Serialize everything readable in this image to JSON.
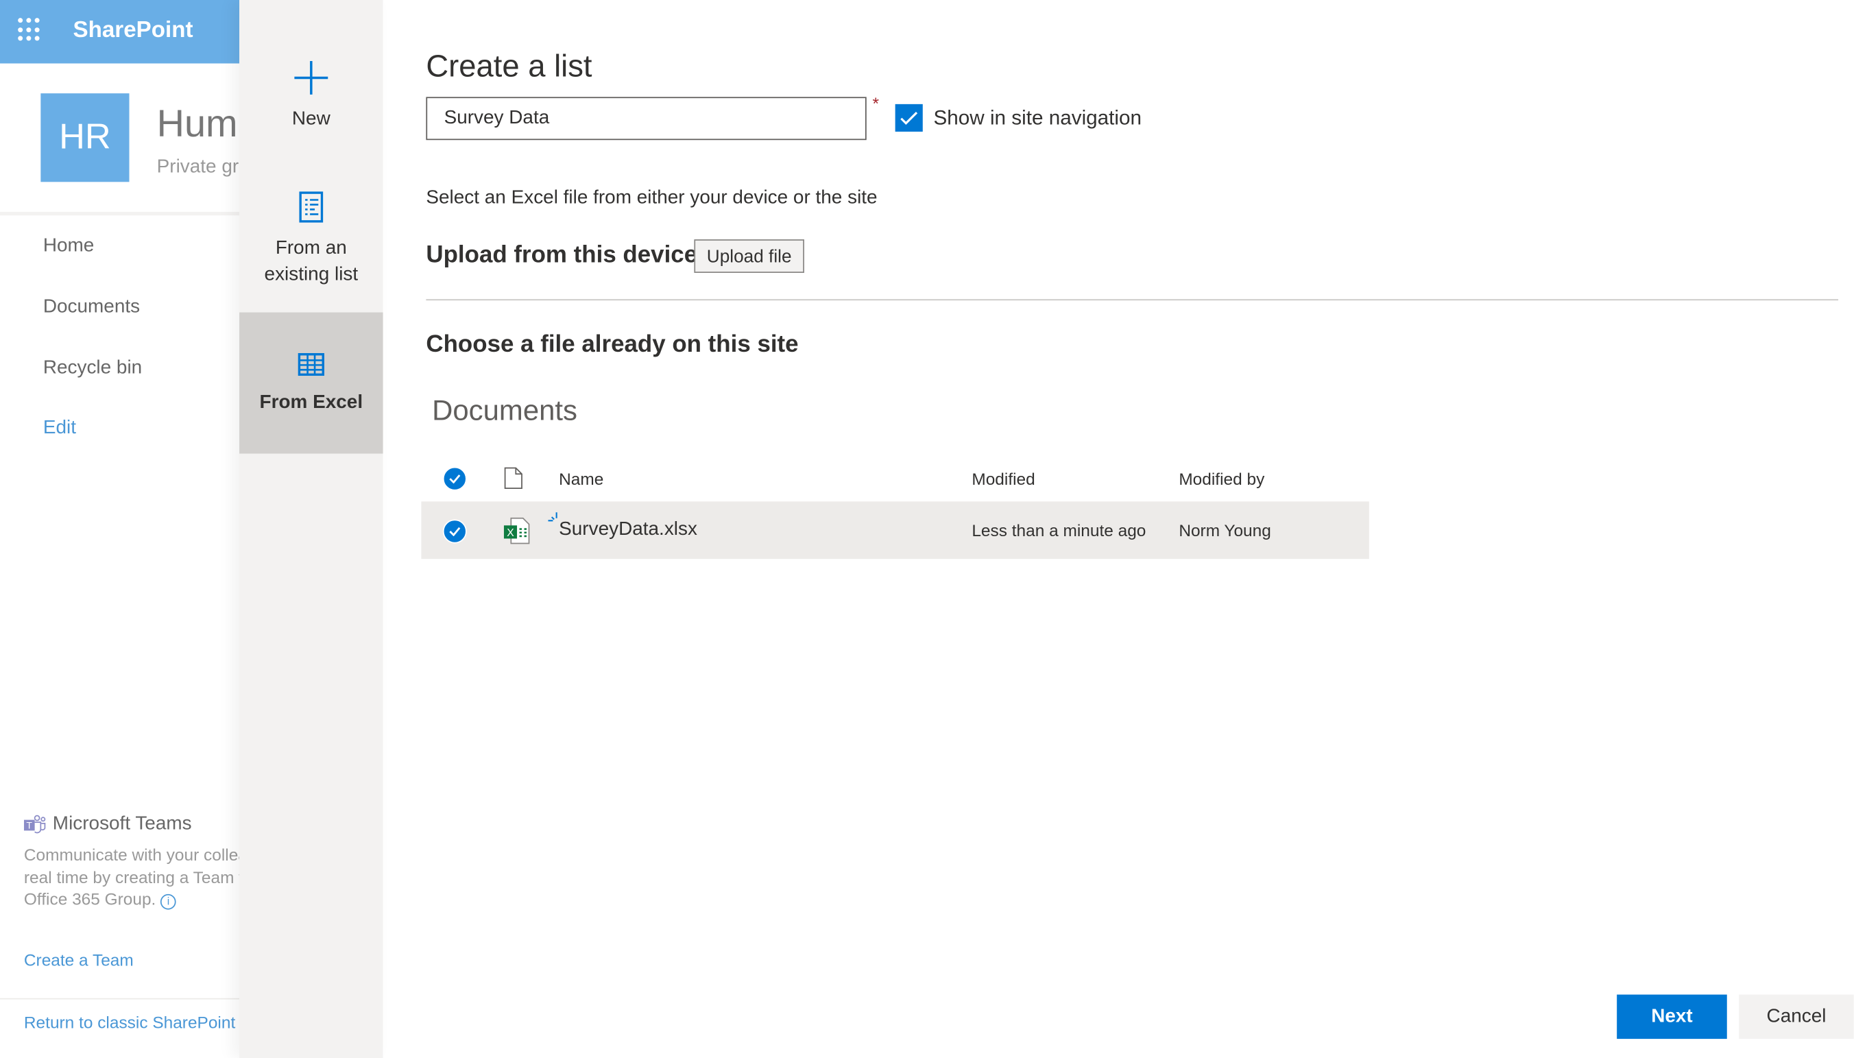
{
  "app": {
    "name": "SharePoint",
    "accent": "#0078d4",
    "header_color": "#69aee6"
  },
  "site": {
    "initials": "HR",
    "title": "Human Resources",
    "subtitle": "Private group"
  },
  "nav": {
    "items": [
      {
        "label": "Home"
      },
      {
        "label": "Documents"
      },
      {
        "label": "Recycle bin"
      }
    ],
    "edit": "Edit"
  },
  "teams": {
    "title": "Microsoft Teams",
    "description": "Communicate with your colleagues in real time by creating a Team for your Office 365 Group.",
    "create": "Create a Team"
  },
  "footer": {
    "classic": "Return to classic SharePoint"
  },
  "options": [
    {
      "label": "New",
      "icon": "plus-icon",
      "selected": false
    },
    {
      "label": "From an existing list",
      "icon": "list-icon",
      "selected": false
    },
    {
      "label": "From Excel",
      "icon": "table-icon",
      "selected": true
    }
  ],
  "form": {
    "title": "Create a list",
    "name_value": "Survey Data",
    "required_mark": "*",
    "show_in_nav": {
      "label": "Show in site navigation",
      "checked": true
    },
    "instruction": "Select an Excel file from either your device or the site",
    "upload_heading": "Upload from this device",
    "upload_button": "Upload file",
    "choose_heading": "Choose a file already on this site",
    "library": "Documents"
  },
  "table": {
    "columns": [
      "Name",
      "Modified",
      "Modified by"
    ],
    "rows": [
      {
        "name": "SurveyData.xlsx",
        "modified": "Less than a minute ago",
        "modified_by": "Norm Young",
        "selected": true,
        "new": true
      }
    ]
  },
  "actions": {
    "next": "Next",
    "cancel": "Cancel"
  }
}
